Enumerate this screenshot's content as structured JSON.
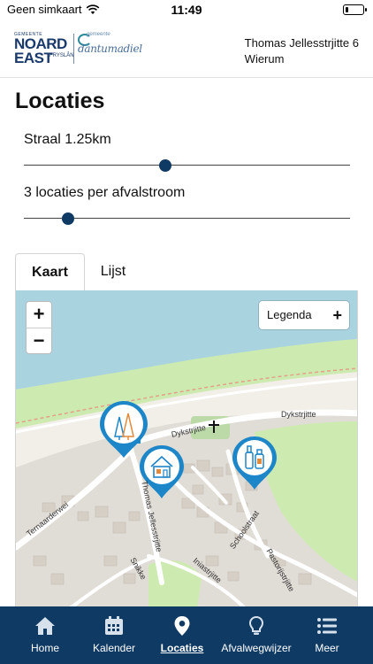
{
  "status_bar": {
    "carrier": "Geen simkaart",
    "time": "11:49",
    "battery_level": 0.15
  },
  "header": {
    "logo_noordeast": {
      "top_text": "GEMEENTE",
      "line1": "NOARD",
      "line2": "EAST",
      "sub": "FRYSLÂN"
    },
    "logo_dantumadiel": {
      "small": "gemeente",
      "main": "dantumadiel"
    },
    "address_line1": "Thomas Jellesstrjitte 6",
    "address_line2": "Wierum"
  },
  "page_title": "Locaties",
  "radius": {
    "label": "Straal 1.25km",
    "value_fraction": 0.43
  },
  "per_stream": {
    "label": "3 locaties per afvalstroom",
    "value_fraction": 0.12
  },
  "tabs": [
    {
      "label": "Kaart",
      "active": true
    },
    {
      "label": "Lijst",
      "active": false
    }
  ],
  "map": {
    "zoom_in": "+",
    "zoom_out": "−",
    "legend_label": "Legenda",
    "legend_plus": "+",
    "streets": [
      "Dykstrjitte",
      "Dykstrjitte",
      "Ternaarderwei",
      "Thomas Jellesstrjitte",
      "Pastorijstrjitte",
      "Iniastrjitte",
      "Schoolstraat",
      "Snikke"
    ],
    "markers": [
      "tree-marker-icon",
      "house-marker-icon",
      "bottles-marker-icon"
    ]
  },
  "colors": {
    "primary": "#0f3a64",
    "marker": "#1d86c8",
    "water": "#a9d3df"
  },
  "nav": [
    {
      "label": "Home",
      "icon": "home-icon",
      "active": false
    },
    {
      "label": "Kalender",
      "icon": "calendar-icon",
      "active": false
    },
    {
      "label": "Locaties",
      "icon": "location-pin-icon",
      "active": true
    },
    {
      "label": "Afvalwegwijzer",
      "icon": "lightbulb-icon",
      "active": false
    },
    {
      "label": "Meer",
      "icon": "menu-list-icon",
      "active": false
    }
  ]
}
